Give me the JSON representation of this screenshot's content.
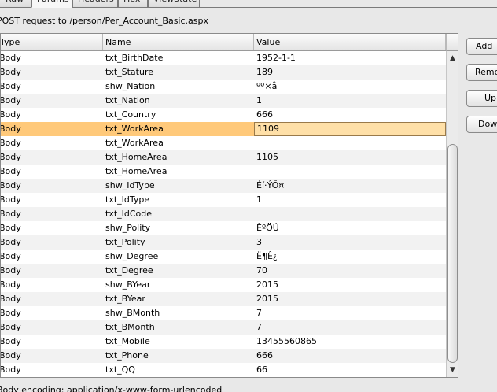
{
  "tabs": [
    {
      "label": "Raw",
      "active": false
    },
    {
      "label": "Params",
      "active": true
    },
    {
      "label": "Headers",
      "active": false
    },
    {
      "label": "Hex",
      "active": false
    },
    {
      "label": "ViewState",
      "active": false
    }
  ],
  "request_line": "POST request to /person/Per_Account_Basic.aspx",
  "table": {
    "columns": [
      "Type",
      "Name",
      "Value"
    ],
    "selected_index": 5,
    "rows": [
      {
        "type": "Body",
        "name": "txt_BirthDate",
        "value": "1952-1-1"
      },
      {
        "type": "Body",
        "name": "txt_Stature",
        "value": "189"
      },
      {
        "type": "Body",
        "name": "shw_Nation",
        "value": "ºº×å"
      },
      {
        "type": "Body",
        "name": "txt_Nation",
        "value": "1"
      },
      {
        "type": "Body",
        "name": "txt_Country",
        "value": "666"
      },
      {
        "type": "Body",
        "name": "txt_WorkArea",
        "value": "1109"
      },
      {
        "type": "Body",
        "name": "txt_WorkArea",
        "value": ""
      },
      {
        "type": "Body",
        "name": "txt_HomeArea",
        "value": "1105"
      },
      {
        "type": "Body",
        "name": "txt_HomeArea",
        "value": ""
      },
      {
        "type": "Body",
        "name": "shw_IdType",
        "value": "Éí·ÝÖ¤"
      },
      {
        "type": "Body",
        "name": "txt_IdType",
        "value": "1"
      },
      {
        "type": "Body",
        "name": "txt_IdCode",
        "value": ""
      },
      {
        "type": "Body",
        "name": "shw_Polity",
        "value": "ÈºÖÚ"
      },
      {
        "type": "Body",
        "name": "txt_Polity",
        "value": "3"
      },
      {
        "type": "Body",
        "name": "shw_Degree",
        "value": "Ë¶Ê¿"
      },
      {
        "type": "Body",
        "name": "txt_Degree",
        "value": "70"
      },
      {
        "type": "Body",
        "name": "shw_BYear",
        "value": "2015"
      },
      {
        "type": "Body",
        "name": "txt_BYear",
        "value": "2015"
      },
      {
        "type": "Body",
        "name": "shw_BMonth",
        "value": "7"
      },
      {
        "type": "Body",
        "name": "txt_BMonth",
        "value": "7"
      },
      {
        "type": "Body",
        "name": "txt_Mobile",
        "value": "13455560865"
      },
      {
        "type": "Body",
        "name": "txt_Phone",
        "value": "666"
      },
      {
        "type": "Body",
        "name": "txt_QQ",
        "value": "66"
      }
    ]
  },
  "scrollbar": {
    "up_icon": "triangle-up-icon",
    "down_icon": "triangle-down-icon"
  },
  "buttons": {
    "add": "Add",
    "remove": "Remove",
    "up": "Up",
    "down": "Down"
  },
  "body_encoding": "Body encoding: application/x-www-form-urlencoded"
}
